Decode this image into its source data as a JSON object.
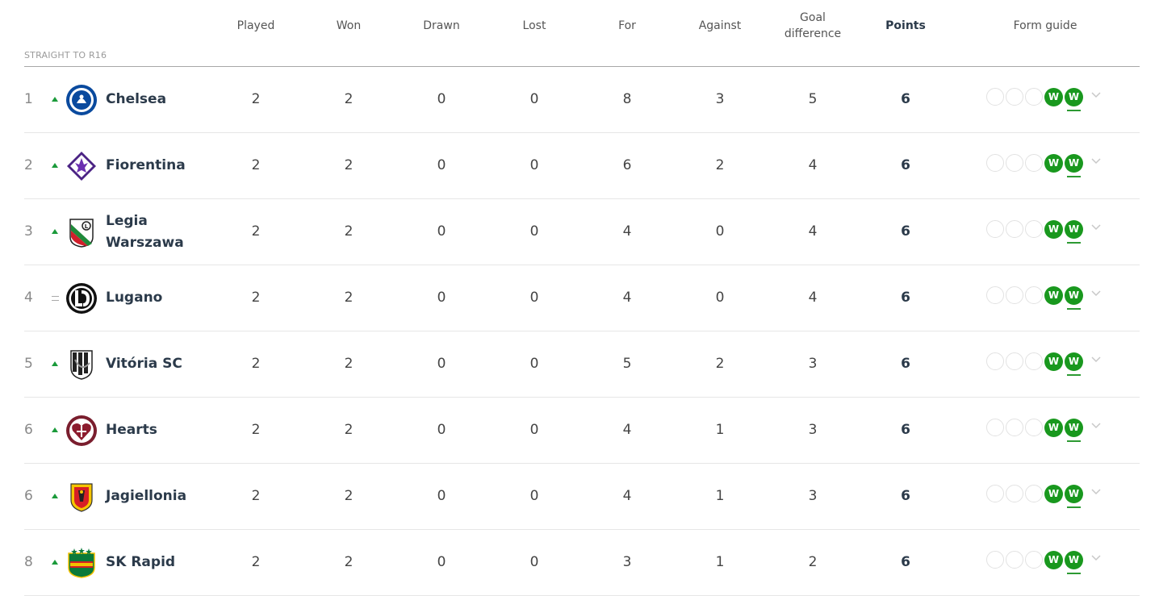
{
  "header": {
    "section_label": "STRAIGHT TO R16",
    "columns": {
      "played": "Played",
      "won": "Won",
      "drawn": "Drawn",
      "lost": "Lost",
      "for": "For",
      "against": "Against",
      "goal_difference_line1": "Goal",
      "goal_difference_line2": "difference",
      "points": "Points",
      "form_guide": "Form guide"
    }
  },
  "colors": {
    "win": "#19981e",
    "up_arrow": "#1a9a3a",
    "text_dark": "#2b3a4a"
  },
  "rows": [
    {
      "pos": "1",
      "movement": "up",
      "crest": "chelsea-crest-icon",
      "team": "Chelsea",
      "played": "2",
      "won": "2",
      "drawn": "0",
      "lost": "0",
      "for": "8",
      "against": "3",
      "gd": "5",
      "points": "6",
      "form": [
        "W",
        "W"
      ]
    },
    {
      "pos": "2",
      "movement": "up",
      "crest": "fiorentina-crest-icon",
      "team": "Fiorentina",
      "played": "2",
      "won": "2",
      "drawn": "0",
      "lost": "0",
      "for": "6",
      "against": "2",
      "gd": "4",
      "points": "6",
      "form": [
        "W",
        "W"
      ]
    },
    {
      "pos": "3",
      "movement": "up",
      "crest": "legia-crest-icon",
      "team": "Legia Warszawa",
      "played": "2",
      "won": "2",
      "drawn": "0",
      "lost": "0",
      "for": "4",
      "against": "0",
      "gd": "4",
      "points": "6",
      "form": [
        "W",
        "W"
      ]
    },
    {
      "pos": "4",
      "movement": "same",
      "crest": "lugano-crest-icon",
      "team": "Lugano",
      "played": "2",
      "won": "2",
      "drawn": "0",
      "lost": "0",
      "for": "4",
      "against": "0",
      "gd": "4",
      "points": "6",
      "form": [
        "W",
        "W"
      ]
    },
    {
      "pos": "5",
      "movement": "up",
      "crest": "vitoria-crest-icon",
      "team": "Vitória SC",
      "played": "2",
      "won": "2",
      "drawn": "0",
      "lost": "0",
      "for": "5",
      "against": "2",
      "gd": "3",
      "points": "6",
      "form": [
        "W",
        "W"
      ]
    },
    {
      "pos": "6",
      "movement": "up",
      "crest": "hearts-crest-icon",
      "team": "Hearts",
      "played": "2",
      "won": "2",
      "drawn": "0",
      "lost": "0",
      "for": "4",
      "against": "1",
      "gd": "3",
      "points": "6",
      "form": [
        "W",
        "W"
      ]
    },
    {
      "pos": "6",
      "movement": "up",
      "crest": "jagiellonia-crest-icon",
      "team": "Jagiellonia",
      "played": "2",
      "won": "2",
      "drawn": "0",
      "lost": "0",
      "for": "4",
      "against": "1",
      "gd": "3",
      "points": "6",
      "form": [
        "W",
        "W"
      ]
    },
    {
      "pos": "8",
      "movement": "up",
      "crest": "rapid-crest-icon",
      "team": "SK Rapid",
      "played": "2",
      "won": "2",
      "drawn": "0",
      "lost": "0",
      "for": "3",
      "against": "1",
      "gd": "2",
      "points": "6",
      "form": [
        "W",
        "W"
      ]
    }
  ]
}
